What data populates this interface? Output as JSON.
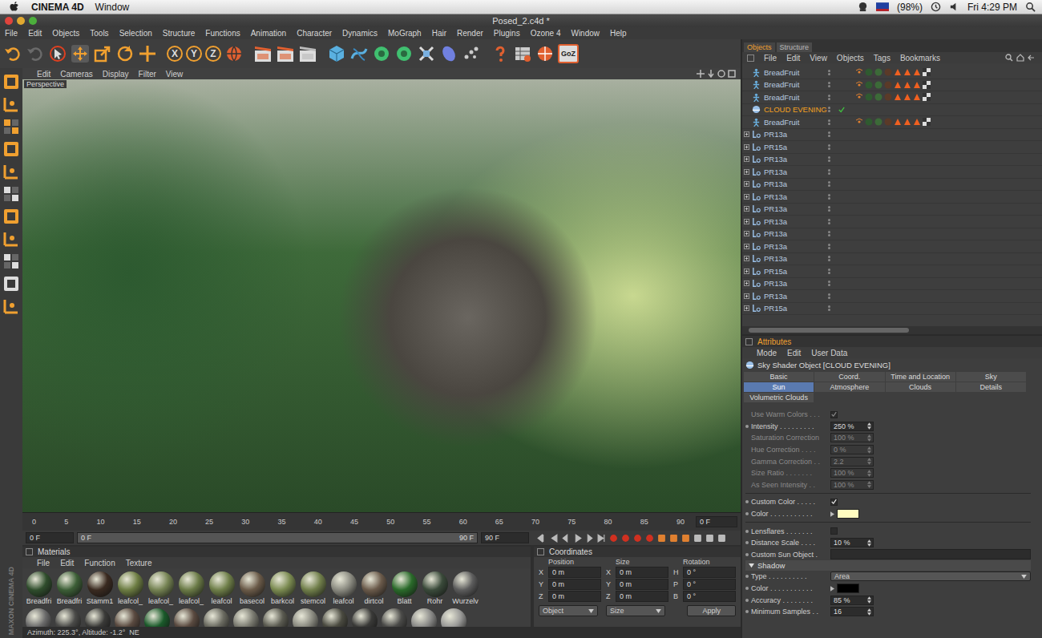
{
  "mac_menubar": {
    "app": "CINEMA 4D",
    "menus": [
      "Window"
    ],
    "battery": "(98%)",
    "clock": "Fri 4:29 PM"
  },
  "window": {
    "title": "Posed_2.c4d *"
  },
  "menu": [
    "File",
    "Edit",
    "Objects",
    "Tools",
    "Selection",
    "Structure",
    "Functions",
    "Animation",
    "Character",
    "Dynamics",
    "MoGraph",
    "Hair",
    "Render",
    "Plugins",
    "Ozone 4",
    "Window",
    "Help"
  ],
  "toolbar": {
    "axis_buttons": [
      "X",
      "Y",
      "Z"
    ],
    "goz": "GoZ"
  },
  "viewport": {
    "menu": [
      "Edit",
      "Cameras",
      "Display",
      "Filter",
      "View"
    ],
    "label": "Perspective"
  },
  "timeline": {
    "ticks": [
      "0",
      "5",
      "10",
      "15",
      "20",
      "25",
      "30",
      "35",
      "40",
      "45",
      "50",
      "55",
      "60",
      "65",
      "70",
      "75",
      "80",
      "85",
      "90"
    ],
    "frame_field": "0 F",
    "start": "0 F",
    "slider_start": "0 F",
    "slider_end": "90 F",
    "end": "90 F"
  },
  "materials": {
    "title": "Materials",
    "menu": [
      "File",
      "Edit",
      "Function",
      "Texture"
    ],
    "items": [
      {
        "label": "Breadfri",
        "color": "#2f4d2c"
      },
      {
        "label": "Breadfri",
        "color": "#3c5e36"
      },
      {
        "label": "Stamm1",
        "color": "#3a2a20"
      },
      {
        "label": "leafcol_",
        "color": "#6c7c42"
      },
      {
        "label": "leafcol_",
        "color": "#748252"
      },
      {
        "label": "leafcol_",
        "color": "#6a7a46"
      },
      {
        "label": "leafcol",
        "color": "#6e7e48"
      },
      {
        "label": "basecol",
        "color": "#6a5a48"
      },
      {
        "label": "barkcol",
        "color": "#7a8a50"
      },
      {
        "label": "stemcol",
        "color": "#707e4a"
      },
      {
        "label": "leafcol",
        "color": "#8a8a80"
      },
      {
        "label": "dirtcol",
        "color": "#6a5a4a"
      },
      {
        "label": "Blatt",
        "color": "#2a6a2a"
      },
      {
        "label": "Rohr",
        "color": "#3a4a3a"
      },
      {
        "label": "Wurzelv",
        "color": "#5c5c5c"
      }
    ],
    "row2": [
      "#6a6a6a",
      "#4a4a48",
      "#3a3a38",
      "#5a4a40",
      "#1a5a2a",
      "#5a4a40",
      "#6a6a60",
      "#7a7a70",
      "#5a5a50",
      "#8a8a80",
      "#4a4a40",
      "#3a3a38",
      "#4a4a48",
      "#8a8a88",
      "#9a9a98"
    ]
  },
  "coordinates": {
    "title": "Coordinates",
    "columns": [
      "Position",
      "Size",
      "Rotation"
    ],
    "rows": [
      {
        "axes": [
          "X",
          "X",
          "H"
        ],
        "values": [
          "0 m",
          "0 m",
          "0 °"
        ]
      },
      {
        "axes": [
          "Y",
          "Y",
          "P"
        ],
        "values": [
          "0 m",
          "0 m",
          "0 °"
        ]
      },
      {
        "axes": [
          "Z",
          "Z",
          "B"
        ],
        "values": [
          "0 m",
          "0 m",
          "0 °"
        ]
      }
    ],
    "dropdowns": [
      "Object",
      "Size"
    ],
    "apply": "Apply"
  },
  "status_bar": "Azimuth: 225.3°, Altitude: -1.2°  NE",
  "brand": "MAXON CINEMA 4D",
  "objects_panel": {
    "tabs": [
      {
        "label": "Objects",
        "selected": true
      },
      {
        "label": "Structure",
        "selected": false
      }
    ],
    "menu": [
      "File",
      "Edit",
      "View",
      "Objects",
      "Tags",
      "Bookmarks"
    ],
    "rows": [
      {
        "name": "BreadFruit",
        "kind": "figure",
        "selected": false,
        "checked": false,
        "tags": true,
        "expandable": false
      },
      {
        "name": "BreadFruit",
        "kind": "figure",
        "selected": false,
        "checked": false,
        "tags": true,
        "expandable": false
      },
      {
        "name": "BreadFruit",
        "kind": "figure",
        "selected": false,
        "checked": false,
        "tags": true,
        "expandable": false
      },
      {
        "name": "CLOUD EVENING",
        "kind": "sky",
        "selected": true,
        "checked": true,
        "tags": false,
        "expandable": false
      },
      {
        "name": "BreadFruit",
        "kind": "figure",
        "selected": false,
        "checked": false,
        "tags": true,
        "expandable": false
      },
      {
        "name": "PR13a",
        "kind": "lod",
        "selected": false,
        "checked": false,
        "tags": false,
        "expandable": true
      },
      {
        "name": "PR15a",
        "kind": "lod",
        "selected": false,
        "checked": false,
        "tags": false,
        "expandable": true
      },
      {
        "name": "PR13a",
        "kind": "lod",
        "selected": false,
        "checked": false,
        "tags": false,
        "expandable": true
      },
      {
        "name": "PR13a",
        "kind": "lod",
        "selected": false,
        "checked": false,
        "tags": false,
        "expandable": true
      },
      {
        "name": "PR13a",
        "kind": "lod",
        "selected": false,
        "checked": false,
        "tags": false,
        "expandable": true
      },
      {
        "name": "PR13a",
        "kind": "lod",
        "selected": false,
        "checked": false,
        "tags": false,
        "expandable": true
      },
      {
        "name": "PR13a",
        "kind": "lod",
        "selected": false,
        "checked": false,
        "tags": false,
        "expandable": true
      },
      {
        "name": "PR13a",
        "kind": "lod",
        "selected": false,
        "checked": false,
        "tags": false,
        "expandable": true
      },
      {
        "name": "PR13a",
        "kind": "lod",
        "selected": false,
        "checked": false,
        "tags": false,
        "expandable": true
      },
      {
        "name": "PR13a",
        "kind": "lod",
        "selected": false,
        "checked": false,
        "tags": false,
        "expandable": true
      },
      {
        "name": "PR13a",
        "kind": "lod",
        "selected": false,
        "checked": false,
        "tags": false,
        "expandable": true
      },
      {
        "name": "PR15a",
        "kind": "lod",
        "selected": false,
        "checked": false,
        "tags": false,
        "expandable": true
      },
      {
        "name": "PR13a",
        "kind": "lod",
        "selected": false,
        "checked": false,
        "tags": false,
        "expandable": true
      },
      {
        "name": "PR13a",
        "kind": "lod",
        "selected": false,
        "checked": false,
        "tags": false,
        "expandable": true
      },
      {
        "name": "PR15a",
        "kind": "lod",
        "selected": false,
        "checked": false,
        "tags": false,
        "expandable": true
      }
    ]
  },
  "attributes": {
    "title": "Attributes",
    "menu": [
      "Mode",
      "Edit",
      "User Data"
    ],
    "object": "Sky Shader Object [CLOUD EVENING]",
    "tabs": [
      {
        "label": "Basic",
        "selected": false
      },
      {
        "label": "Coord.",
        "selected": false
      },
      {
        "label": "Time and Location",
        "selected": false
      },
      {
        "label": "Sky",
        "selected": false
      },
      {
        "label": "Sun",
        "selected": true
      },
      {
        "label": "Atmosphere",
        "selected": false
      },
      {
        "label": "Clouds",
        "selected": false
      },
      {
        "label": "Details",
        "selected": false
      },
      {
        "label": "Volumetric Clouds",
        "selected": false
      }
    ],
    "properties": [
      {
        "kind": "checkbox",
        "label": "Use Warm Colors . . .",
        "checked": true,
        "disabled": true
      },
      {
        "kind": "number",
        "label": "Intensity . . . . . . . . .",
        "value": "250 %",
        "disabled": false
      },
      {
        "kind": "number",
        "label": "Saturation Correction",
        "value": "100 %",
        "disabled": true
      },
      {
        "kind": "number",
        "label": "Hue Correction . . . .",
        "value": "0 %",
        "disabled": true
      },
      {
        "kind": "number",
        "label": "Gamma Correction . .",
        "value": "2.2",
        "disabled": true
      },
      {
        "kind": "number",
        "label": "Size Ratio . . . . . . .",
        "value": "100 %",
        "disabled": true
      },
      {
        "kind": "number",
        "label": "As Seen Intensity . .",
        "value": "100 %",
        "disabled": true
      },
      {
        "kind": "separator"
      },
      {
        "kind": "checkbox",
        "label": "Custom Color . . . . .",
        "checked": true,
        "disabled": false
      },
      {
        "kind": "color",
        "label": "Color . . . . . . . . . . .",
        "color": "#fffcc0",
        "disabled": false
      },
      {
        "kind": "separator"
      },
      {
        "kind": "checkbox",
        "label": "Lensflares . . . . . . .",
        "checked": false,
        "disabled": false
      },
      {
        "kind": "number",
        "label": "Distance Scale . . . .",
        "value": "10 %",
        "disabled": false
      },
      {
        "kind": "field",
        "label": "Custom Sun Object .",
        "value": "",
        "disabled": false
      },
      {
        "kind": "section",
        "label": "Shadow",
        "expanded": true
      },
      {
        "kind": "dropdown",
        "label": "Type . . . . . . . . . .",
        "value": "Area",
        "disabled": false
      },
      {
        "kind": "color",
        "label": "Color . . . . . . . . . . .",
        "color": "#000000",
        "disabled": false
      },
      {
        "kind": "number",
        "label": "Accuracy . . . . . . . .",
        "value": "85 %",
        "disabled": false
      },
      {
        "kind": "number",
        "label": "Minimum Samples . .",
        "value": "16",
        "disabled": false
      }
    ]
  }
}
